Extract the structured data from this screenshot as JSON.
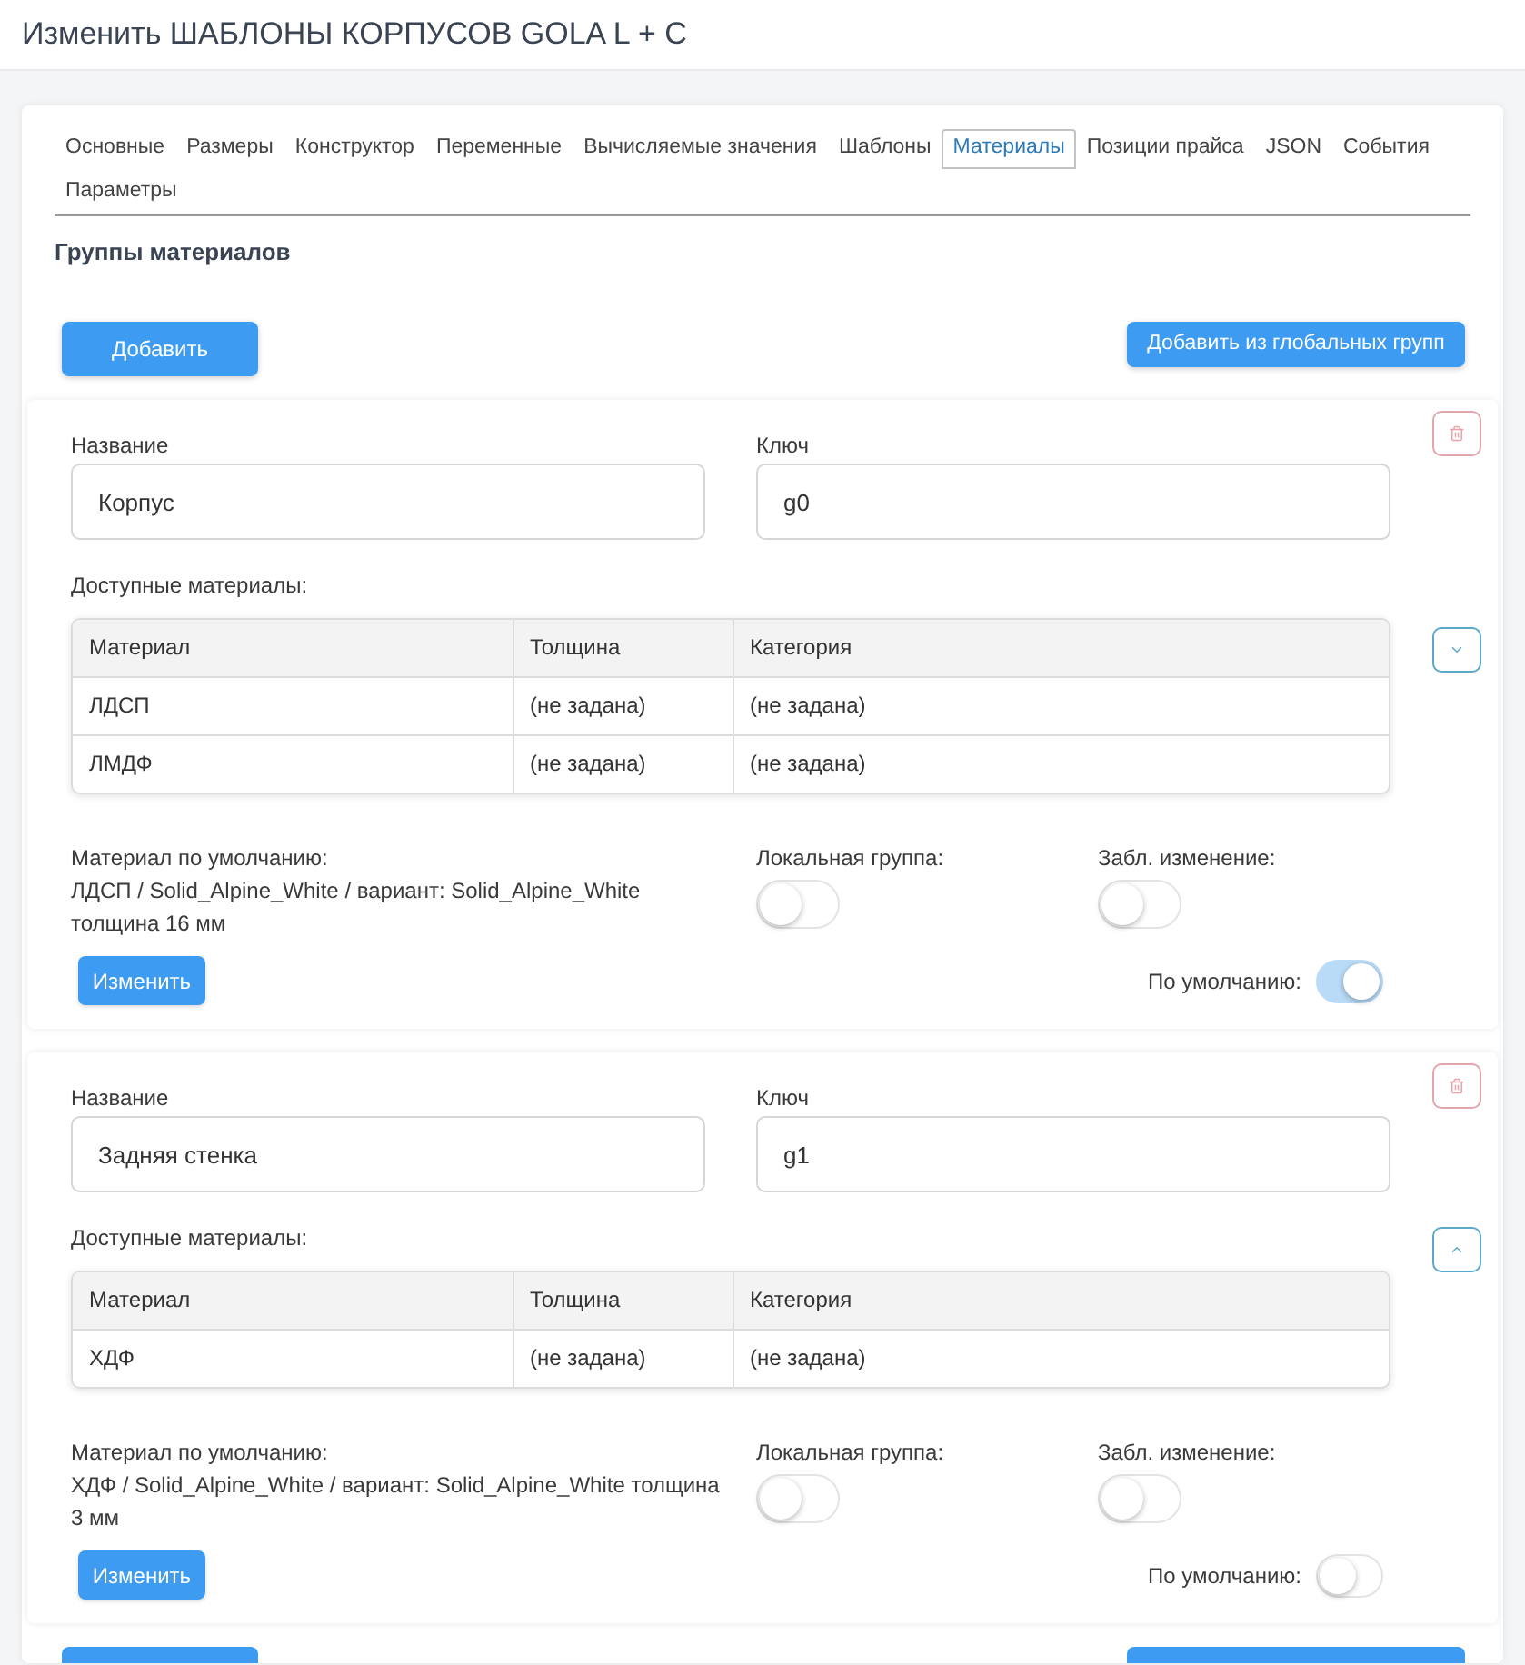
{
  "page": {
    "title": "Изменить ШАБЛОНЫ КОРПУСОВ GOLA L + C"
  },
  "tabs": [
    {
      "label": "Основные",
      "selected": false
    },
    {
      "label": "Размеры",
      "selected": false
    },
    {
      "label": "Конструктор",
      "selected": false
    },
    {
      "label": "Переменные",
      "selected": false
    },
    {
      "label": "Вычисляемые значения",
      "selected": false
    },
    {
      "label": "Шаблоны",
      "selected": false
    },
    {
      "label": "Материалы",
      "selected": true
    },
    {
      "label": "Позиции прайса",
      "selected": false
    },
    {
      "label": "JSON",
      "selected": false
    },
    {
      "label": "События",
      "selected": false
    },
    {
      "label": "Параметры",
      "selected": false
    }
  ],
  "section": {
    "title": "Группы материалов",
    "add_button": "Добавить",
    "add_global_button": "Добавить из глобальных групп"
  },
  "groups": [
    {
      "name_field": {
        "label": "Название",
        "value": "Корпус"
      },
      "key_field": {
        "label": "Ключ",
        "value": "g0"
      },
      "can_move_up": false,
      "can_move_down": true,
      "materials_label": "Доступные материалы:",
      "table": {
        "columns": [
          "Материал",
          "Толщина",
          "Категория"
        ],
        "rows": [
          [
            "ЛДСП",
            "(не задана)",
            "(не задана)"
          ],
          [
            "ЛМДФ",
            "(не задана)",
            "(не задана)"
          ]
        ]
      },
      "default_material": {
        "label": "Материал по умолчанию:",
        "value": "ЛДСП / Solid_Alpine_White / вариант: Solid_Alpine_White толщина 16 мм"
      },
      "edit_button": "Изменить",
      "local_group": {
        "label": "Локальная группа:",
        "on": false
      },
      "lock_change": {
        "label": "Забл. изменение:",
        "on": false
      },
      "is_default": {
        "label": "По умолчанию:",
        "on": true
      }
    },
    {
      "name_field": {
        "label": "Название",
        "value": "Задняя стенка"
      },
      "key_field": {
        "label": "Ключ",
        "value": "g1"
      },
      "can_move_up": true,
      "can_move_down": false,
      "materials_label": "Доступные материалы:",
      "table": {
        "columns": [
          "Материал",
          "Толщина",
          "Категория"
        ],
        "rows": [
          [
            "ХДФ",
            "(не задана)",
            "(не задана)"
          ]
        ]
      },
      "default_material": {
        "label": "Материал по умолчанию:",
        "value": "ХДФ / Solid_Alpine_White / вариант: Solid_Alpine_White толщина 3 мм"
      },
      "edit_button": "Изменить",
      "local_group": {
        "label": "Локальная группа:",
        "on": false
      },
      "lock_change": {
        "label": "Забл. изменение:",
        "on": false
      },
      "is_default": {
        "label": "По умолчанию:",
        "on": false
      }
    }
  ]
}
